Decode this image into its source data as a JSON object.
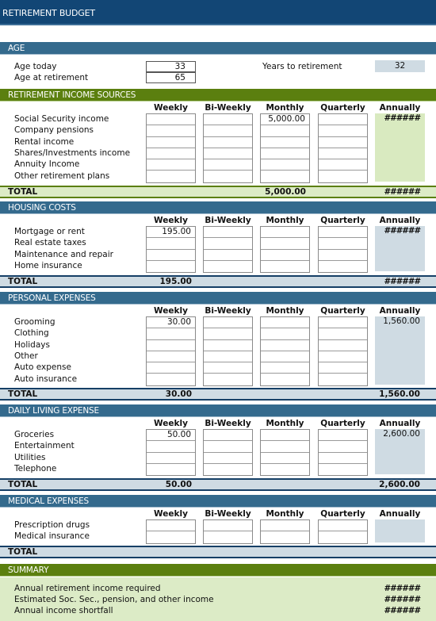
{
  "title": "RETIREMENT BUDGET",
  "columns": [
    "Weekly",
    "Bi-Weekly",
    "Monthly",
    "Quarterly",
    "Annually"
  ],
  "age": {
    "header": "AGE",
    "age_today_label": "Age today",
    "age_today": "33",
    "age_retirement_label": "Age at retirement",
    "age_retirement": "65",
    "years_label": "Years to retirement",
    "years": "32"
  },
  "income": {
    "header": "RETIREMENT INCOME SOURCES",
    "rows": [
      {
        "label": "Social Security income",
        "weekly": "",
        "biweekly": "",
        "monthly": "5,000.00",
        "quarterly": "",
        "annually": "######"
      },
      {
        "label": "Company pensions",
        "weekly": "",
        "biweekly": "",
        "monthly": "",
        "quarterly": "",
        "annually": ""
      },
      {
        "label": "Rental income",
        "weekly": "",
        "biweekly": "",
        "monthly": "",
        "quarterly": "",
        "annually": ""
      },
      {
        "label": "Shares/Investments income",
        "weekly": "",
        "biweekly": "",
        "monthly": "",
        "quarterly": "",
        "annually": ""
      },
      {
        "label": "Annuity Income",
        "weekly": "",
        "biweekly": "",
        "monthly": "",
        "quarterly": "",
        "annually": ""
      },
      {
        "label": "Other retirement plans",
        "weekly": "",
        "biweekly": "",
        "monthly": "",
        "quarterly": "",
        "annually": ""
      }
    ],
    "total": {
      "label": "TOTAL",
      "weekly": "",
      "biweekly": "",
      "monthly": "5,000.00",
      "quarterly": "",
      "annually": "######"
    }
  },
  "housing": {
    "header": "HOUSING COSTS",
    "rows": [
      {
        "label": "Mortgage or rent",
        "weekly": "195.00",
        "biweekly": "",
        "monthly": "",
        "quarterly": "",
        "annually": "######"
      },
      {
        "label": "Real estate taxes",
        "weekly": "",
        "biweekly": "",
        "monthly": "",
        "quarterly": "",
        "annually": ""
      },
      {
        "label": "Maintenance and repair",
        "weekly": "",
        "biweekly": "",
        "monthly": "",
        "quarterly": "",
        "annually": ""
      },
      {
        "label": "Home insurance",
        "weekly": "",
        "biweekly": "",
        "monthly": "",
        "quarterly": "",
        "annually": ""
      }
    ],
    "total": {
      "label": "TOTAL",
      "weekly": "195.00",
      "biweekly": "",
      "monthly": "",
      "quarterly": "",
      "annually": "######"
    }
  },
  "personal": {
    "header": "PERSONAL EXPENSES",
    "rows": [
      {
        "label": "Grooming",
        "weekly": "30.00",
        "biweekly": "",
        "monthly": "",
        "quarterly": "",
        "annually": "1,560.00"
      },
      {
        "label": "Clothing",
        "weekly": "",
        "biweekly": "",
        "monthly": "",
        "quarterly": "",
        "annually": ""
      },
      {
        "label": "Holidays",
        "weekly": "",
        "biweekly": "",
        "monthly": "",
        "quarterly": "",
        "annually": ""
      },
      {
        "label": "Other",
        "weekly": "",
        "biweekly": "",
        "monthly": "",
        "quarterly": "",
        "annually": ""
      },
      {
        "label": "Auto expense",
        "weekly": "",
        "biweekly": "",
        "monthly": "",
        "quarterly": "",
        "annually": ""
      },
      {
        "label": "Auto insurance",
        "weekly": "",
        "biweekly": "",
        "monthly": "",
        "quarterly": "",
        "annually": ""
      }
    ],
    "total": {
      "label": "TOTAL",
      "weekly": "30.00",
      "biweekly": "",
      "monthly": "",
      "quarterly": "",
      "annually": "1,560.00"
    }
  },
  "daily": {
    "header": "DAILY LIVING EXPENSE",
    "rows": [
      {
        "label": "Groceries",
        "weekly": "50.00",
        "biweekly": "",
        "monthly": "",
        "quarterly": "",
        "annually": "2,600.00"
      },
      {
        "label": "Entertainment",
        "weekly": "",
        "biweekly": "",
        "monthly": "",
        "quarterly": "",
        "annually": ""
      },
      {
        "label": "Utilities",
        "weekly": "",
        "biweekly": "",
        "monthly": "",
        "quarterly": "",
        "annually": ""
      },
      {
        "label": "Telephone",
        "weekly": "",
        "biweekly": "",
        "monthly": "",
        "quarterly": "",
        "annually": ""
      }
    ],
    "total": {
      "label": "TOTAL",
      "weekly": "50.00",
      "biweekly": "",
      "monthly": "",
      "quarterly": "",
      "annually": "2,600.00"
    }
  },
  "medical": {
    "header": "MEDICAL EXPENSES",
    "rows": [
      {
        "label": "Prescription drugs",
        "weekly": "",
        "biweekly": "",
        "monthly": "",
        "quarterly": "",
        "annually": ""
      },
      {
        "label": "Medical insurance",
        "weekly": "",
        "biweekly": "",
        "monthly": "",
        "quarterly": "",
        "annually": ""
      }
    ],
    "total": {
      "label": "TOTAL",
      "weekly": "",
      "biweekly": "",
      "monthly": "",
      "quarterly": "",
      "annually": ""
    }
  },
  "summary": {
    "header": "SUMMARY",
    "rows": [
      {
        "label": "Annual retirement income required",
        "value": "######"
      },
      {
        "label": "Estimated Soc. Sec., pension, and other income",
        "value": "######"
      },
      {
        "label": "Annual income shortfall",
        "value": "######"
      }
    ]
  },
  "colors": {
    "title_bg": "#124675",
    "section_blue": "#346a8d",
    "section_green": "#5b7f0f",
    "annual_green": "#d9eac0",
    "annual_blue": "#cfdbe3"
  }
}
